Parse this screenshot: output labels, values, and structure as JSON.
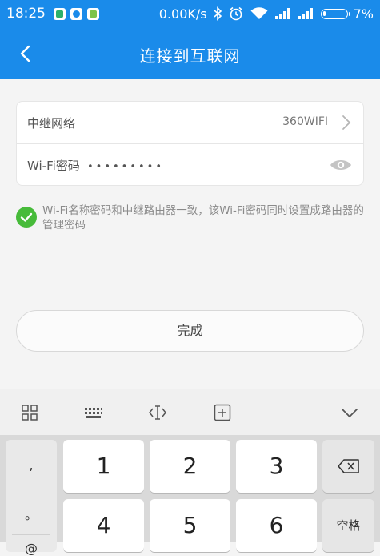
{
  "status_bar": {
    "time": "18:25",
    "net_speed": "0.00K/s",
    "battery_percent": "7%",
    "icons": [
      "shield-icon",
      "cloud-icon",
      "android-icon",
      "bluetooth-icon",
      "alarm-icon",
      "wifi-icon",
      "signal-icon",
      "signal-icon",
      "battery-icon"
    ]
  },
  "header": {
    "title": "连接到互联网",
    "back_icon": "chevron-left-icon"
  },
  "form": {
    "relay_network_label": "中继网络",
    "relay_network_value": "360WIFI",
    "password_label": "Wi-Fi密码",
    "password_value": "•••••••••"
  },
  "notice": {
    "checked": true,
    "text": "Wi-Fi名称密码和中继路由器一致，该Wi-Fi密码同时设置成路由器的管理密码"
  },
  "done_button": {
    "label": "完成"
  },
  "keyboard": {
    "toolbar_icons": [
      "grid-icon",
      "keyboard-icon",
      "cursor-icon",
      "plus-box-icon",
      "chevron-down-icon"
    ],
    "side_symbols": [
      ",",
      "。",
      "@"
    ],
    "keys_row1": [
      "1",
      "2",
      "3"
    ],
    "keys_row2": [
      "4",
      "5",
      "6"
    ],
    "backspace_icon": "backspace-icon",
    "space_label": "空格"
  },
  "colors": {
    "primary": "#1a8bea",
    "check_green": "#47bb3a"
  }
}
